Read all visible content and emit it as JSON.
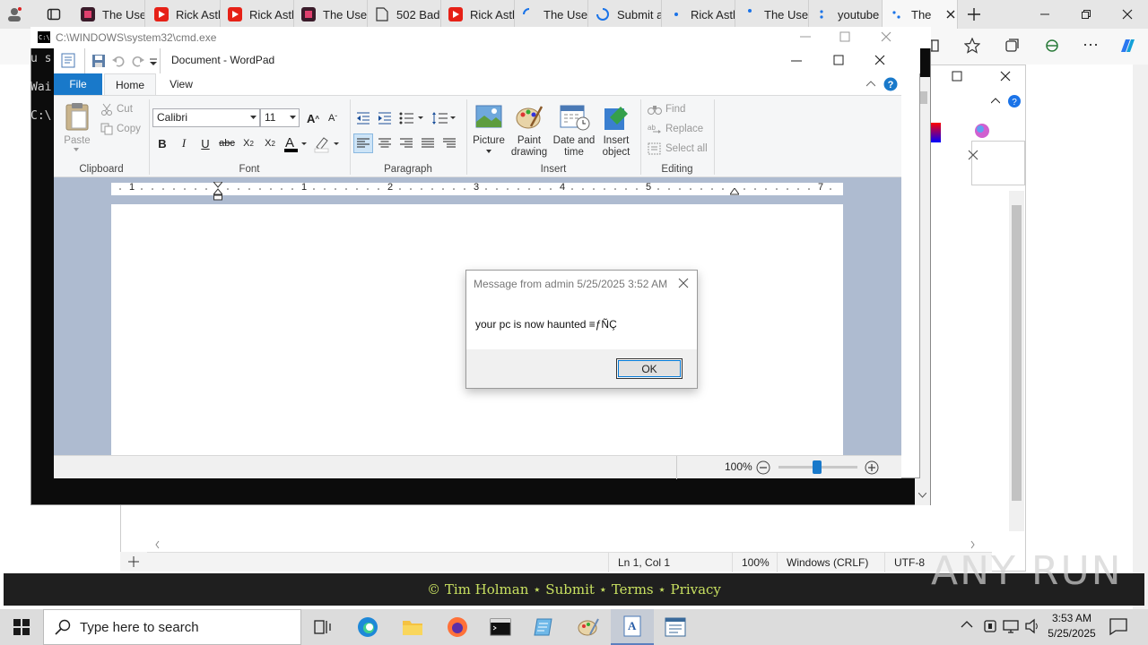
{
  "browser": {
    "tabs": [
      {
        "label": "",
        "icon": "profile-icon"
      },
      {
        "label": "",
        "icon": "tab-actions-icon"
      },
      {
        "label": "The Usel",
        "icon": "useless-web-icon"
      },
      {
        "label": "Rick Astl",
        "icon": "youtube-icon"
      },
      {
        "label": "Rick Astl",
        "icon": "youtube-icon"
      },
      {
        "label": "The Usel",
        "icon": "useless-web-icon"
      },
      {
        "label": "502 Bad",
        "icon": "page-icon"
      },
      {
        "label": "Rick Astl",
        "icon": "youtube-icon"
      },
      {
        "label": "The Usel",
        "icon": "loading-icon"
      },
      {
        "label": "Submit a",
        "icon": "loading-icon"
      },
      {
        "label": "Rick Astl",
        "icon": "dot-icon"
      },
      {
        "label": "The Usel",
        "icon": "dot-icon"
      },
      {
        "label": "youtube",
        "icon": "dot-icon"
      },
      {
        "label": "The",
        "icon": "loading-icon"
      }
    ],
    "footer": "© Tim Holman ⋆ Submit ⋆ Terms ⋆ Privacy"
  },
  "cmd": {
    "title": "C:\\WINDOWS\\system32\\cmd.exe",
    "lines": [
      "u s",
      "Wai",
      "C:\\"
    ]
  },
  "notepad": {
    "status": {
      "position": "Ln 1, Col 1",
      "zoom": "100%",
      "line_ending": "Windows (CRLF)",
      "encoding": "UTF-8"
    }
  },
  "wordpad": {
    "title": "Document - WordPad",
    "tabs": {
      "file": "File",
      "home": "Home",
      "view": "View"
    },
    "clipboard": {
      "paste": "Paste",
      "cut": "Cut",
      "copy": "Copy",
      "label": "Clipboard"
    },
    "font": {
      "family": "Calibri",
      "size": "11",
      "label": "Font"
    },
    "paragraph": {
      "label": "Paragraph"
    },
    "insert": {
      "picture": "Picture",
      "paint": "Paint drawing",
      "datetime": "Date and time",
      "object": "Insert object",
      "label": "Insert"
    },
    "editing": {
      "find": "Find",
      "replace": "Replace",
      "select_all": "Select all",
      "label": "Editing"
    },
    "ruler": [
      "1",
      "1",
      "2",
      "3",
      "4",
      "5",
      "7"
    ],
    "zoom": "100%"
  },
  "message_box": {
    "title": "Message from admin 5/25/2025 3:52 AM",
    "body": "your pc is now haunted ≡ƒÑÇ",
    "ok": "OK"
  },
  "taskbar": {
    "search_placeholder": "Type here to search",
    "time": "3:53 AM",
    "date": "5/25/2025"
  },
  "watermark": "ANY RUN",
  "colors": {
    "ribbon_file": "#1979ca",
    "footer_text": "#c8e060",
    "doc_area": "#aebbd0"
  }
}
